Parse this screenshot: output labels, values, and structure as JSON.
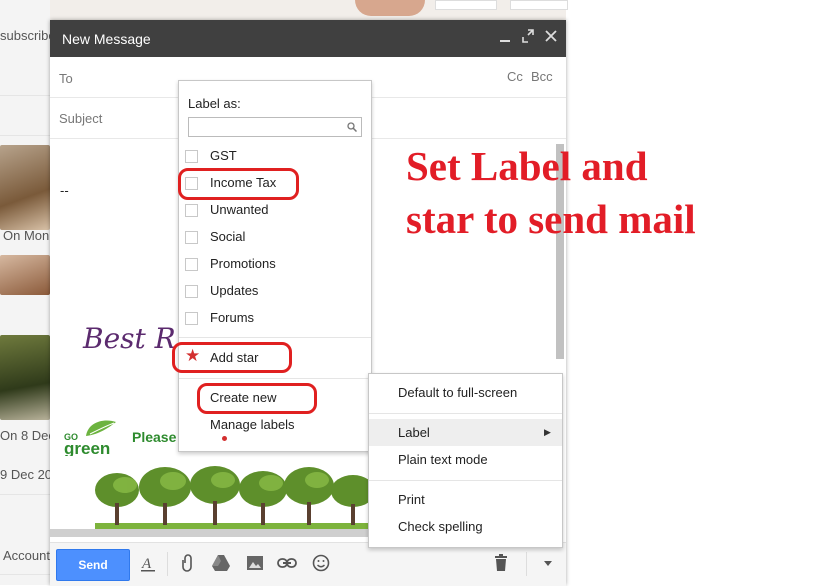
{
  "background": {
    "snippets": [
      "subscribe",
      "On Mon",
      "On 8 Dec",
      "9 Dec 20",
      "Account"
    ]
  },
  "compose": {
    "title": "New Message",
    "to_label": "To",
    "cc_label": "Cc",
    "bcc_label": "Bcc",
    "subject_label": "Subject",
    "signature_dash": "--",
    "signature_text": "Best R",
    "please_text": "Please",
    "send_label": "Send"
  },
  "label_menu": {
    "header": "Label as:",
    "search_value": "",
    "labels": [
      "GST",
      "Income Tax",
      "Unwanted",
      "Social",
      "Promotions",
      "Updates",
      "Forums"
    ],
    "add_star": "Add star",
    "create_new": "Create new",
    "manage_labels": "Manage labels"
  },
  "context_menu": {
    "items": [
      "Default to full-screen",
      "Label",
      "Plain text mode",
      "Print",
      "Check spelling"
    ]
  },
  "annotation": {
    "line1": "Set Label and",
    "line2": "star to send mail"
  },
  "colors": {
    "header_bg": "#404040",
    "send_blue": "#4d90fe",
    "annotation_red": "#e21d27",
    "highlight_red": "#e02020"
  },
  "icons": {
    "minimize": "minimize-icon",
    "popout": "popout-icon",
    "close": "close-icon",
    "search": "search-icon",
    "star": "star-icon",
    "submenu": "chevron-right-icon",
    "formatting": "formatting-icon",
    "attach": "paperclip-icon",
    "drive": "drive-icon",
    "photo": "photo-icon",
    "link": "link-icon",
    "emoji": "emoji-icon",
    "trash": "trash-icon",
    "more": "more-options-icon"
  }
}
